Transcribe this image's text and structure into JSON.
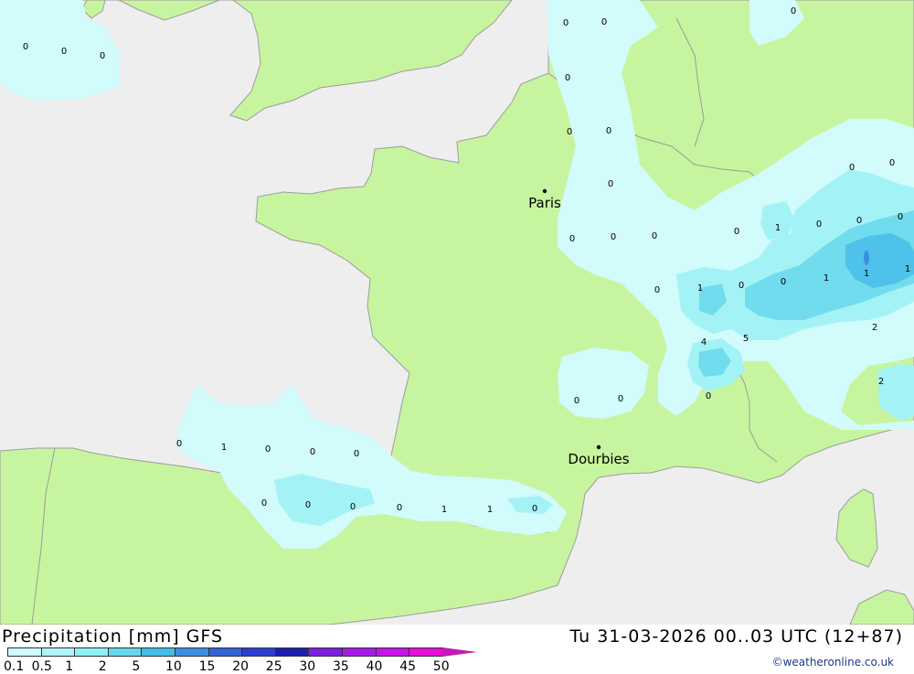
{
  "map": {
    "cities": [
      {
        "name": "Paris"
      },
      {
        "name": "Dourbies"
      }
    ],
    "value_labels": [
      "0",
      "0",
      "0",
      "0",
      "0",
      "0",
      "0",
      "0",
      "0",
      "0",
      "0",
      "0",
      "0",
      "1",
      "0",
      "0",
      "0",
      "0",
      "0",
      "0",
      "0",
      "1",
      "0",
      "0",
      "1",
      "1",
      "1",
      "2",
      "4",
      "5",
      "2",
      "0",
      "0",
      "0",
      "0",
      "1",
      "0",
      "0",
      "0",
      "0",
      "0",
      "0",
      "0",
      "1",
      "1",
      "0",
      "0",
      "0",
      "1",
      "0"
    ]
  },
  "footer": {
    "title": "Precipitation [mm] GFS",
    "datetime": "Tu 31-03-2026 00..03 UTC (12+87)",
    "credit": "©weatheronline.co.uk"
  },
  "legend": {
    "labels": [
      "0.1",
      "0.5",
      "1",
      "2",
      "5",
      "10",
      "15",
      "20",
      "25",
      "30",
      "35",
      "40",
      "45",
      "50"
    ],
    "colors": [
      "#cffaff",
      "#b0f3fb",
      "#8ef0f4",
      "#67d8ec",
      "#44bde6",
      "#3c8fe0",
      "#3563d9",
      "#2c3fd0",
      "#1d1fb0",
      "#7c1fe0",
      "#a51ae6",
      "#c812ea",
      "#e80ed6",
      "#c01cb4"
    ]
  },
  "colors": {
    "sea": "#eeeeee",
    "land": "#c7f59f",
    "precip_light": "#d2fbfb",
    "precip_mid": "#a3f3f6",
    "precip_high": "#71dced",
    "precip_peak": "#4ec2ea"
  }
}
